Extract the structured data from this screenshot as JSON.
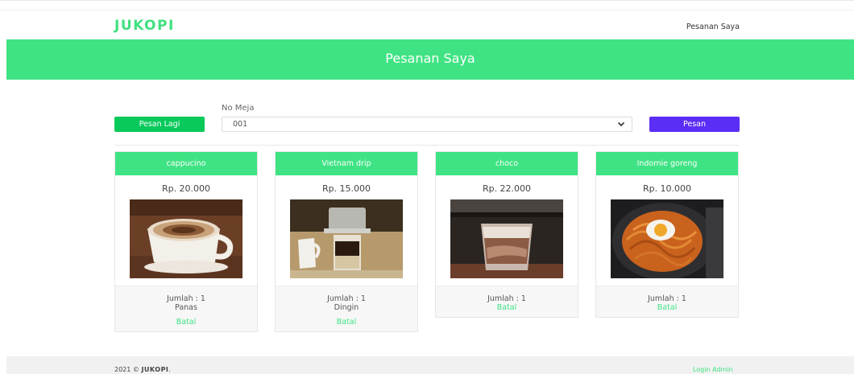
{
  "header": {
    "brand": "JUKOPI",
    "nav_link": "Pesanan Saya",
    "brand_color": "#3fe07f"
  },
  "hero": {
    "title": "Pesanan Saya",
    "color": "#3fe383"
  },
  "order_form": {
    "pesan_lagi_label": "Pesan Lagi",
    "meja_label": "No Meja",
    "meja_value": "001",
    "pesan_label": "Pesan",
    "pesan_color": "#5b2ef5",
    "pesan_lagi_color": "#08c95a"
  },
  "cards": [
    {
      "name": "cappucino",
      "price": "Rp. 20.000",
      "jumlah": "Jumlah : 1",
      "option": "Panas",
      "cancel": "Batal",
      "image": "cappuccino-image"
    },
    {
      "name": "Vietnam drip",
      "price": "Rp. 15.000",
      "jumlah": "Jumlah : 1",
      "option": "Dingin",
      "cancel": "Batal",
      "image": "vietnam-drip-image"
    },
    {
      "name": "choco",
      "price": "Rp. 22.000",
      "jumlah": "Jumlah : 1",
      "option": "",
      "cancel": "Batal",
      "image": "choco-image"
    },
    {
      "name": "Indomie goreng",
      "price": "Rp. 10.000",
      "jumlah": "Jumlah : 1",
      "option": "",
      "cancel": "Batal",
      "image": "indomie-image"
    }
  ],
  "footer": {
    "copyright_prefix": "2021 © ",
    "copyright_brand": "JUKOPI",
    "copyright_suffix": ".",
    "login_admin": "Login Admin"
  },
  "icons": {
    "select_chevron": "chevron-down-icon"
  }
}
